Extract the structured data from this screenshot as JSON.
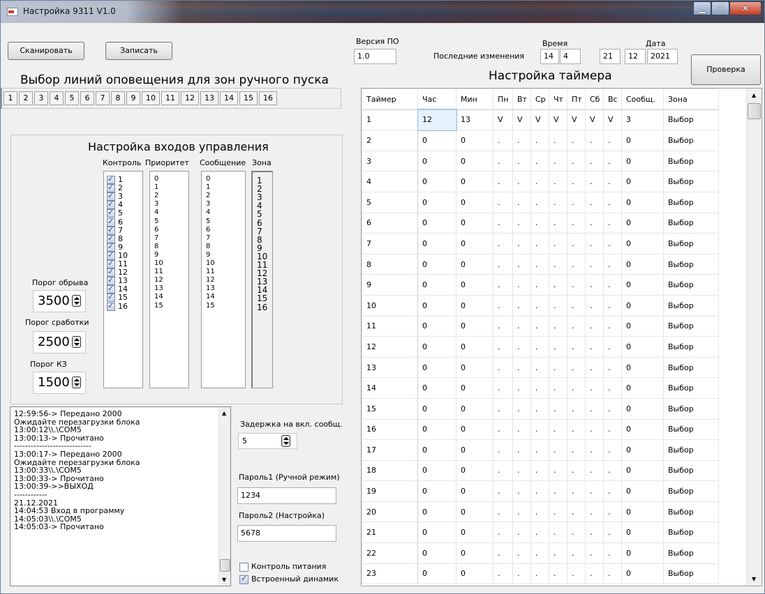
{
  "window": {
    "title": "Настройка 9311 V1.0"
  },
  "toolbar": {
    "scan_label": "Сканировать",
    "write_label": "Записать",
    "check_label": "Проверка"
  },
  "version": {
    "label": "Версия ПО",
    "value": "1.0"
  },
  "last_change": {
    "label": "Последние изменения",
    "time_label": "Время",
    "date_label": "Дата",
    "hour": "14",
    "minute": "4",
    "day": "21",
    "month": "12",
    "year": "2021"
  },
  "lines": {
    "title": "Выбор линий оповещения для зон ручного пуска",
    "items": [
      "1",
      "2",
      "3",
      "4",
      "5",
      "6",
      "7",
      "8",
      "9",
      "10",
      "11",
      "12",
      "13",
      "14",
      "15",
      "16"
    ]
  },
  "inputs": {
    "title": "Настройка входов управления",
    "headers": {
      "control": "Контроль",
      "priority": "Приоритет",
      "message": "Сообщение",
      "zone": "Зона"
    },
    "control": [
      "1",
      "2",
      "3",
      "4",
      "5",
      "6",
      "7",
      "8",
      "9",
      "10",
      "11",
      "12",
      "13",
      "14",
      "15",
      "16"
    ],
    "priority": [
      "0",
      "1",
      "2",
      "3",
      "4",
      "5",
      "6",
      "7",
      "8",
      "9",
      "10",
      "11",
      "12",
      "13",
      "14",
      "15"
    ],
    "message": [
      "0",
      "1",
      "2",
      "3",
      "4",
      "5",
      "6",
      "7",
      "8",
      "9",
      "10",
      "11",
      "12",
      "13",
      "14",
      "15"
    ],
    "zone": [
      "1",
      "2",
      "3",
      "4",
      "5",
      "6",
      "7",
      "8",
      "9",
      "10",
      "11",
      "12",
      "13",
      "14",
      "15",
      "16"
    ]
  },
  "thresholds": {
    "break_label": "Порог обрыва",
    "break_value": "3500",
    "trigger_label": "Порог сработки",
    "trigger_value": "2500",
    "short_label": "Порог КЗ",
    "short_value": "1500"
  },
  "log": {
    "lines": [
      "12:59:56-> Передано 2000",
      "Ожидайте перезагрузки блока",
      "13:00:12\\\\.\\COM5",
      "13:00:13-> Прочитано",
      "----------------------------",
      "13:00:17-> Передано 2000",
      "Ожидайте перезагрузки блока",
      "13:00:33\\\\.\\COM5",
      "13:00:33-> Прочитано",
      "13:00:39->>ВЫХОД",
      "------------",
      "21.12.2021",
      "14:04:53 Вход в программу",
      "14:05:03\\\\.\\COM5",
      "14:05:03-> Прочитано"
    ]
  },
  "settings": {
    "delay_label": "Задержка на вкл. сообщ.",
    "delay_value": "5",
    "pass1_label": "Пароль1 (Ручной режим)",
    "pass1_value": "1234",
    "pass2_label": "Пароль2 (Настройка)",
    "pass2_value": "5678",
    "power_label": "Контроль питания",
    "power_checked": false,
    "speaker_label": "Встроенный динамик",
    "speaker_checked": true
  },
  "timer": {
    "title": "Настройка таймера",
    "headers": [
      "Таймер",
      "Час",
      "Мин",
      "Пн",
      "Вт",
      "Ср",
      "Чт",
      "Пт",
      "Сб",
      "Вс",
      "Сообщ.",
      "Зона"
    ],
    "rows": [
      [
        "1",
        "12",
        "13",
        "V",
        "V",
        "V",
        "V",
        "V",
        "V",
        "V",
        "3",
        "Выбор"
      ],
      [
        "2",
        "0",
        "0",
        ".",
        ".",
        ".",
        ".",
        ".",
        ".",
        ".",
        "0",
        "Выбор"
      ],
      [
        "3",
        "0",
        "0",
        ".",
        ".",
        ".",
        ".",
        ".",
        ".",
        ".",
        "0",
        "Выбор"
      ],
      [
        "4",
        "0",
        "0",
        ".",
        ".",
        ".",
        ".",
        ".",
        ".",
        ".",
        "0",
        "Выбор"
      ],
      [
        "5",
        "0",
        "0",
        ".",
        ".",
        ".",
        ".",
        ".",
        ".",
        ".",
        "0",
        "Выбор"
      ],
      [
        "6",
        "0",
        "0",
        ".",
        ".",
        ".",
        ".",
        ".",
        ".",
        ".",
        "0",
        "Выбор"
      ],
      [
        "7",
        "0",
        "0",
        ".",
        ".",
        ".",
        ".",
        ".",
        ".",
        ".",
        "0",
        "Выбор"
      ],
      [
        "8",
        "0",
        "0",
        ".",
        ".",
        ".",
        ".",
        ".",
        ".",
        ".",
        "0",
        "Выбор"
      ],
      [
        "9",
        "0",
        "0",
        ".",
        ".",
        ".",
        ".",
        ".",
        ".",
        ".",
        "0",
        "Выбор"
      ],
      [
        "10",
        "0",
        "0",
        ".",
        ".",
        ".",
        ".",
        ".",
        ".",
        ".",
        "0",
        "Выбор"
      ],
      [
        "11",
        "0",
        "0",
        ".",
        ".",
        ".",
        ".",
        ".",
        ".",
        ".",
        "0",
        "Выбор"
      ],
      [
        "12",
        "0",
        "0",
        ".",
        ".",
        ".",
        ".",
        ".",
        ".",
        ".",
        "0",
        "Выбор"
      ],
      [
        "13",
        "0",
        "0",
        ".",
        ".",
        ".",
        ".",
        ".",
        ".",
        ".",
        "0",
        "Выбор"
      ],
      [
        "14",
        "0",
        "0",
        ".",
        ".",
        ".",
        ".",
        ".",
        ".",
        ".",
        "0",
        "Выбор"
      ],
      [
        "15",
        "0",
        "0",
        ".",
        ".",
        ".",
        ".",
        ".",
        ".",
        ".",
        "0",
        "Выбор"
      ],
      [
        "16",
        "0",
        "0",
        ".",
        ".",
        ".",
        ".",
        ".",
        ".",
        ".",
        "0",
        "Выбор"
      ],
      [
        "17",
        "0",
        "0",
        ".",
        ".",
        ".",
        ".",
        ".",
        ".",
        ".",
        "0",
        "Выбор"
      ],
      [
        "18",
        "0",
        "0",
        ".",
        ".",
        ".",
        ".",
        ".",
        ".",
        ".",
        "0",
        "Выбор"
      ],
      [
        "19",
        "0",
        "0",
        ".",
        ".",
        ".",
        ".",
        ".",
        ".",
        ".",
        "0",
        "Выбор"
      ],
      [
        "20",
        "0",
        "0",
        ".",
        ".",
        ".",
        ".",
        ".",
        ".",
        ".",
        "0",
        "Выбор"
      ],
      [
        "21",
        "0",
        "0",
        ".",
        ".",
        ".",
        ".",
        ".",
        ".",
        ".",
        "0",
        "Выбор"
      ],
      [
        "22",
        "0",
        "0",
        ".",
        ".",
        ".",
        ".",
        ".",
        ".",
        ".",
        "0",
        "Выбор"
      ],
      [
        "23",
        "0",
        "0",
        ".",
        ".",
        ".",
        ".",
        ".",
        ".",
        ".",
        "0",
        "Выбор"
      ]
    ]
  }
}
